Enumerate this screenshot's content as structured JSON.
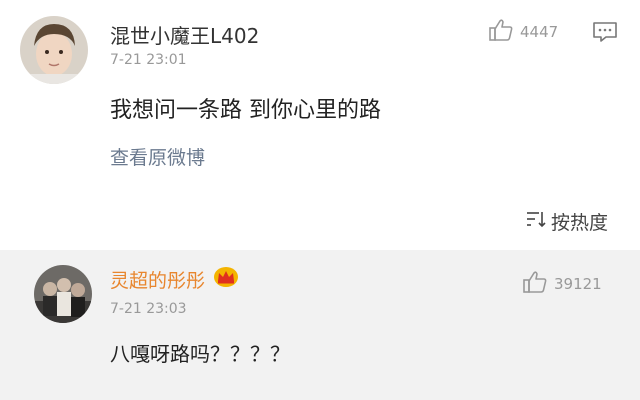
{
  "post": {
    "username": "混世小魔王L402",
    "time": "7-21 23:01",
    "like_count": "4447",
    "content": "我想问一条路 到你心里的路",
    "view_original": "查看原微博"
  },
  "sort": {
    "label": "按热度",
    "icon": "sort-icon"
  },
  "reply": {
    "username": "灵超的彤彤",
    "time": "7-21 23:03",
    "like_count": "39121",
    "content": "八嘎呀路吗？？？？"
  },
  "colors": {
    "username_highlight": "#e8862e",
    "meta_gray": "#999999",
    "link": "#6b7a8f",
    "reply_bg": "#f2f2f2"
  },
  "icons": {
    "like": "thumbs-up-icon",
    "comment": "comment-icon",
    "badge": "crown-icon"
  }
}
